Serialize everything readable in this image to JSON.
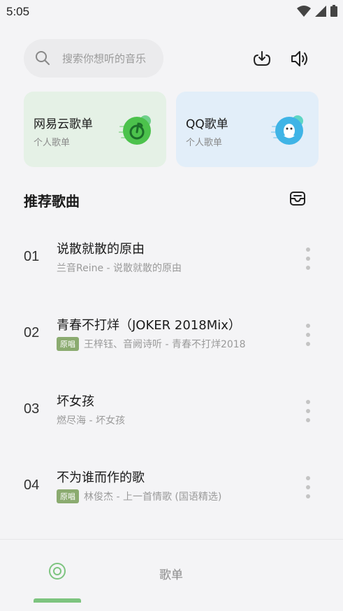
{
  "status_bar": {
    "time": "5:05"
  },
  "search": {
    "placeholder": "搜索你想听的音乐"
  },
  "cards": [
    {
      "title": "网易云歌单",
      "subtitle": "个人歌单",
      "accent": "#4cc24c"
    },
    {
      "title": "QQ歌单",
      "subtitle": "个人歌单",
      "accent": "#3fb4e6"
    }
  ],
  "section": {
    "title": "推荐歌曲"
  },
  "songs": [
    {
      "num": "01",
      "title": "说散就散的原由",
      "meta": "兰音Reine - 说散就散的原由",
      "badge": ""
    },
    {
      "num": "02",
      "title": "青春不打烊（JOKER 2018Mix）",
      "meta": "王梓钰、音阙诗听 - 青春不打烊2018",
      "badge": "原唱"
    },
    {
      "num": "03",
      "title": "坏女孩",
      "meta": "燃尽海 - 坏女孩",
      "badge": ""
    },
    {
      "num": "04",
      "title": "不为谁而作的歌",
      "meta": "林俊杰 - 上一首情歌 (国语精选)",
      "badge": "原唱"
    }
  ],
  "bottom_nav": {
    "playlist_label": "歌单"
  },
  "colors": {
    "accent_green": "#7dc47f",
    "badge_green": "#8bab70"
  }
}
